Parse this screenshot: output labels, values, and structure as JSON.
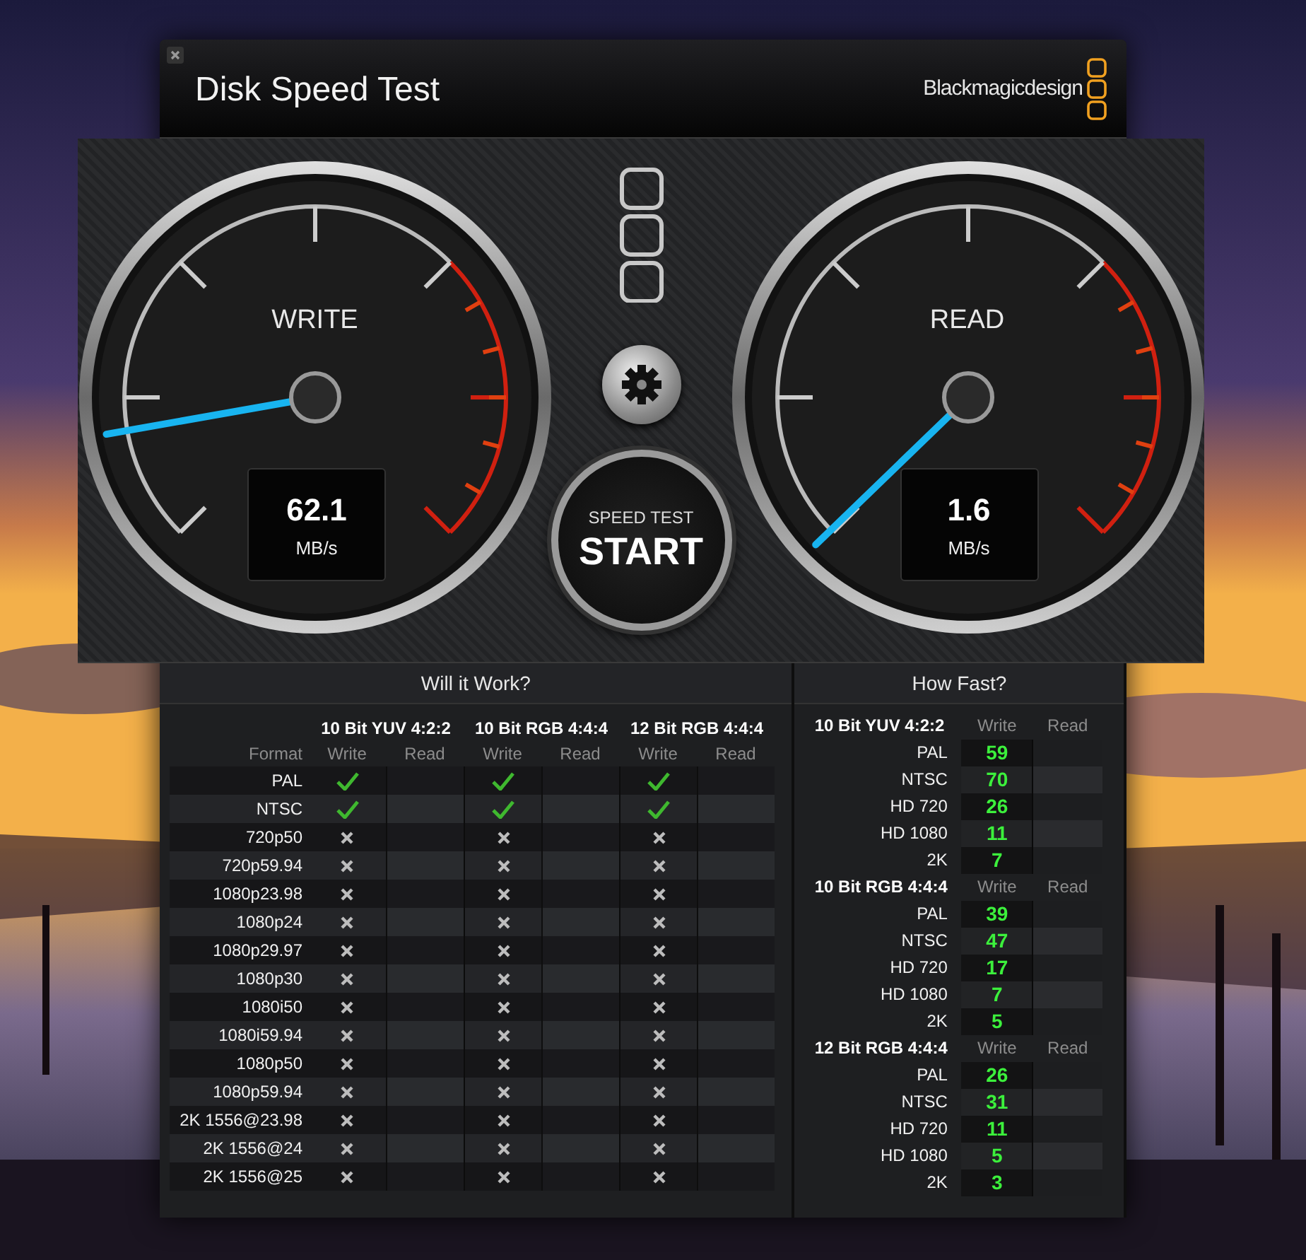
{
  "window": {
    "title": "Disk Speed Test",
    "brand": "Blackmagicdesign"
  },
  "gauges": [
    {
      "label": "WRITE",
      "value": "62.1",
      "unit": "MB/s"
    },
    {
      "label": "READ",
      "value": "1.6",
      "unit": "MB/s"
    }
  ],
  "start_button": {
    "caption": "SPEED TEST",
    "label": "START"
  },
  "will_it_work": {
    "title": "Will it Work?",
    "format_label": "Format",
    "groups": [
      {
        "name": "10 Bit YUV 4:2:2",
        "write": "Write",
        "read": "Read"
      },
      {
        "name": "10 Bit RGB 4:4:4",
        "write": "Write",
        "read": "Read"
      },
      {
        "name": "12 Bit RGB 4:4:4",
        "write": "Write",
        "read": "Read"
      }
    ],
    "rows": [
      {
        "format": "PAL",
        "write_ok": [
          true,
          true,
          true
        ]
      },
      {
        "format": "NTSC",
        "write_ok": [
          true,
          true,
          true
        ]
      },
      {
        "format": "720p50",
        "write_ok": [
          false,
          false,
          false
        ]
      },
      {
        "format": "720p59.94",
        "write_ok": [
          false,
          false,
          false
        ]
      },
      {
        "format": "1080p23.98",
        "write_ok": [
          false,
          false,
          false
        ]
      },
      {
        "format": "1080p24",
        "write_ok": [
          false,
          false,
          false
        ]
      },
      {
        "format": "1080p29.97",
        "write_ok": [
          false,
          false,
          false
        ]
      },
      {
        "format": "1080p30",
        "write_ok": [
          false,
          false,
          false
        ]
      },
      {
        "format": "1080i50",
        "write_ok": [
          false,
          false,
          false
        ]
      },
      {
        "format": "1080i59.94",
        "write_ok": [
          false,
          false,
          false
        ]
      },
      {
        "format": "1080p50",
        "write_ok": [
          false,
          false,
          false
        ]
      },
      {
        "format": "1080p59.94",
        "write_ok": [
          false,
          false,
          false
        ]
      },
      {
        "format": "2K 1556@23.98",
        "write_ok": [
          false,
          false,
          false
        ]
      },
      {
        "format": "2K 1556@24",
        "write_ok": [
          false,
          false,
          false
        ]
      },
      {
        "format": "2K 1556@25",
        "write_ok": [
          false,
          false,
          false
        ]
      }
    ]
  },
  "how_fast": {
    "title": "How Fast?",
    "sections": [
      {
        "name": "10 Bit YUV 4:2:2",
        "write": "Write",
        "read": "Read",
        "rows": [
          {
            "format": "PAL",
            "write": "59"
          },
          {
            "format": "NTSC",
            "write": "70"
          },
          {
            "format": "HD 720",
            "write": "26"
          },
          {
            "format": "HD 1080",
            "write": "11"
          },
          {
            "format": "2K",
            "write": "7"
          }
        ]
      },
      {
        "name": "10 Bit RGB 4:4:4",
        "write": "Write",
        "read": "Read",
        "rows": [
          {
            "format": "PAL",
            "write": "39"
          },
          {
            "format": "NTSC",
            "write": "47"
          },
          {
            "format": "HD 720",
            "write": "17"
          },
          {
            "format": "HD 1080",
            "write": "7"
          },
          {
            "format": "2K",
            "write": "5"
          }
        ]
      },
      {
        "name": "12 Bit RGB 4:4:4",
        "write": "Write",
        "read": "Read",
        "rows": [
          {
            "format": "PAL",
            "write": "26"
          },
          {
            "format": "NTSC",
            "write": "31"
          },
          {
            "format": "HD 720",
            "write": "11"
          },
          {
            "format": "HD 1080",
            "write": "5"
          },
          {
            "format": "2K",
            "write": "3"
          }
        ]
      }
    ]
  }
}
